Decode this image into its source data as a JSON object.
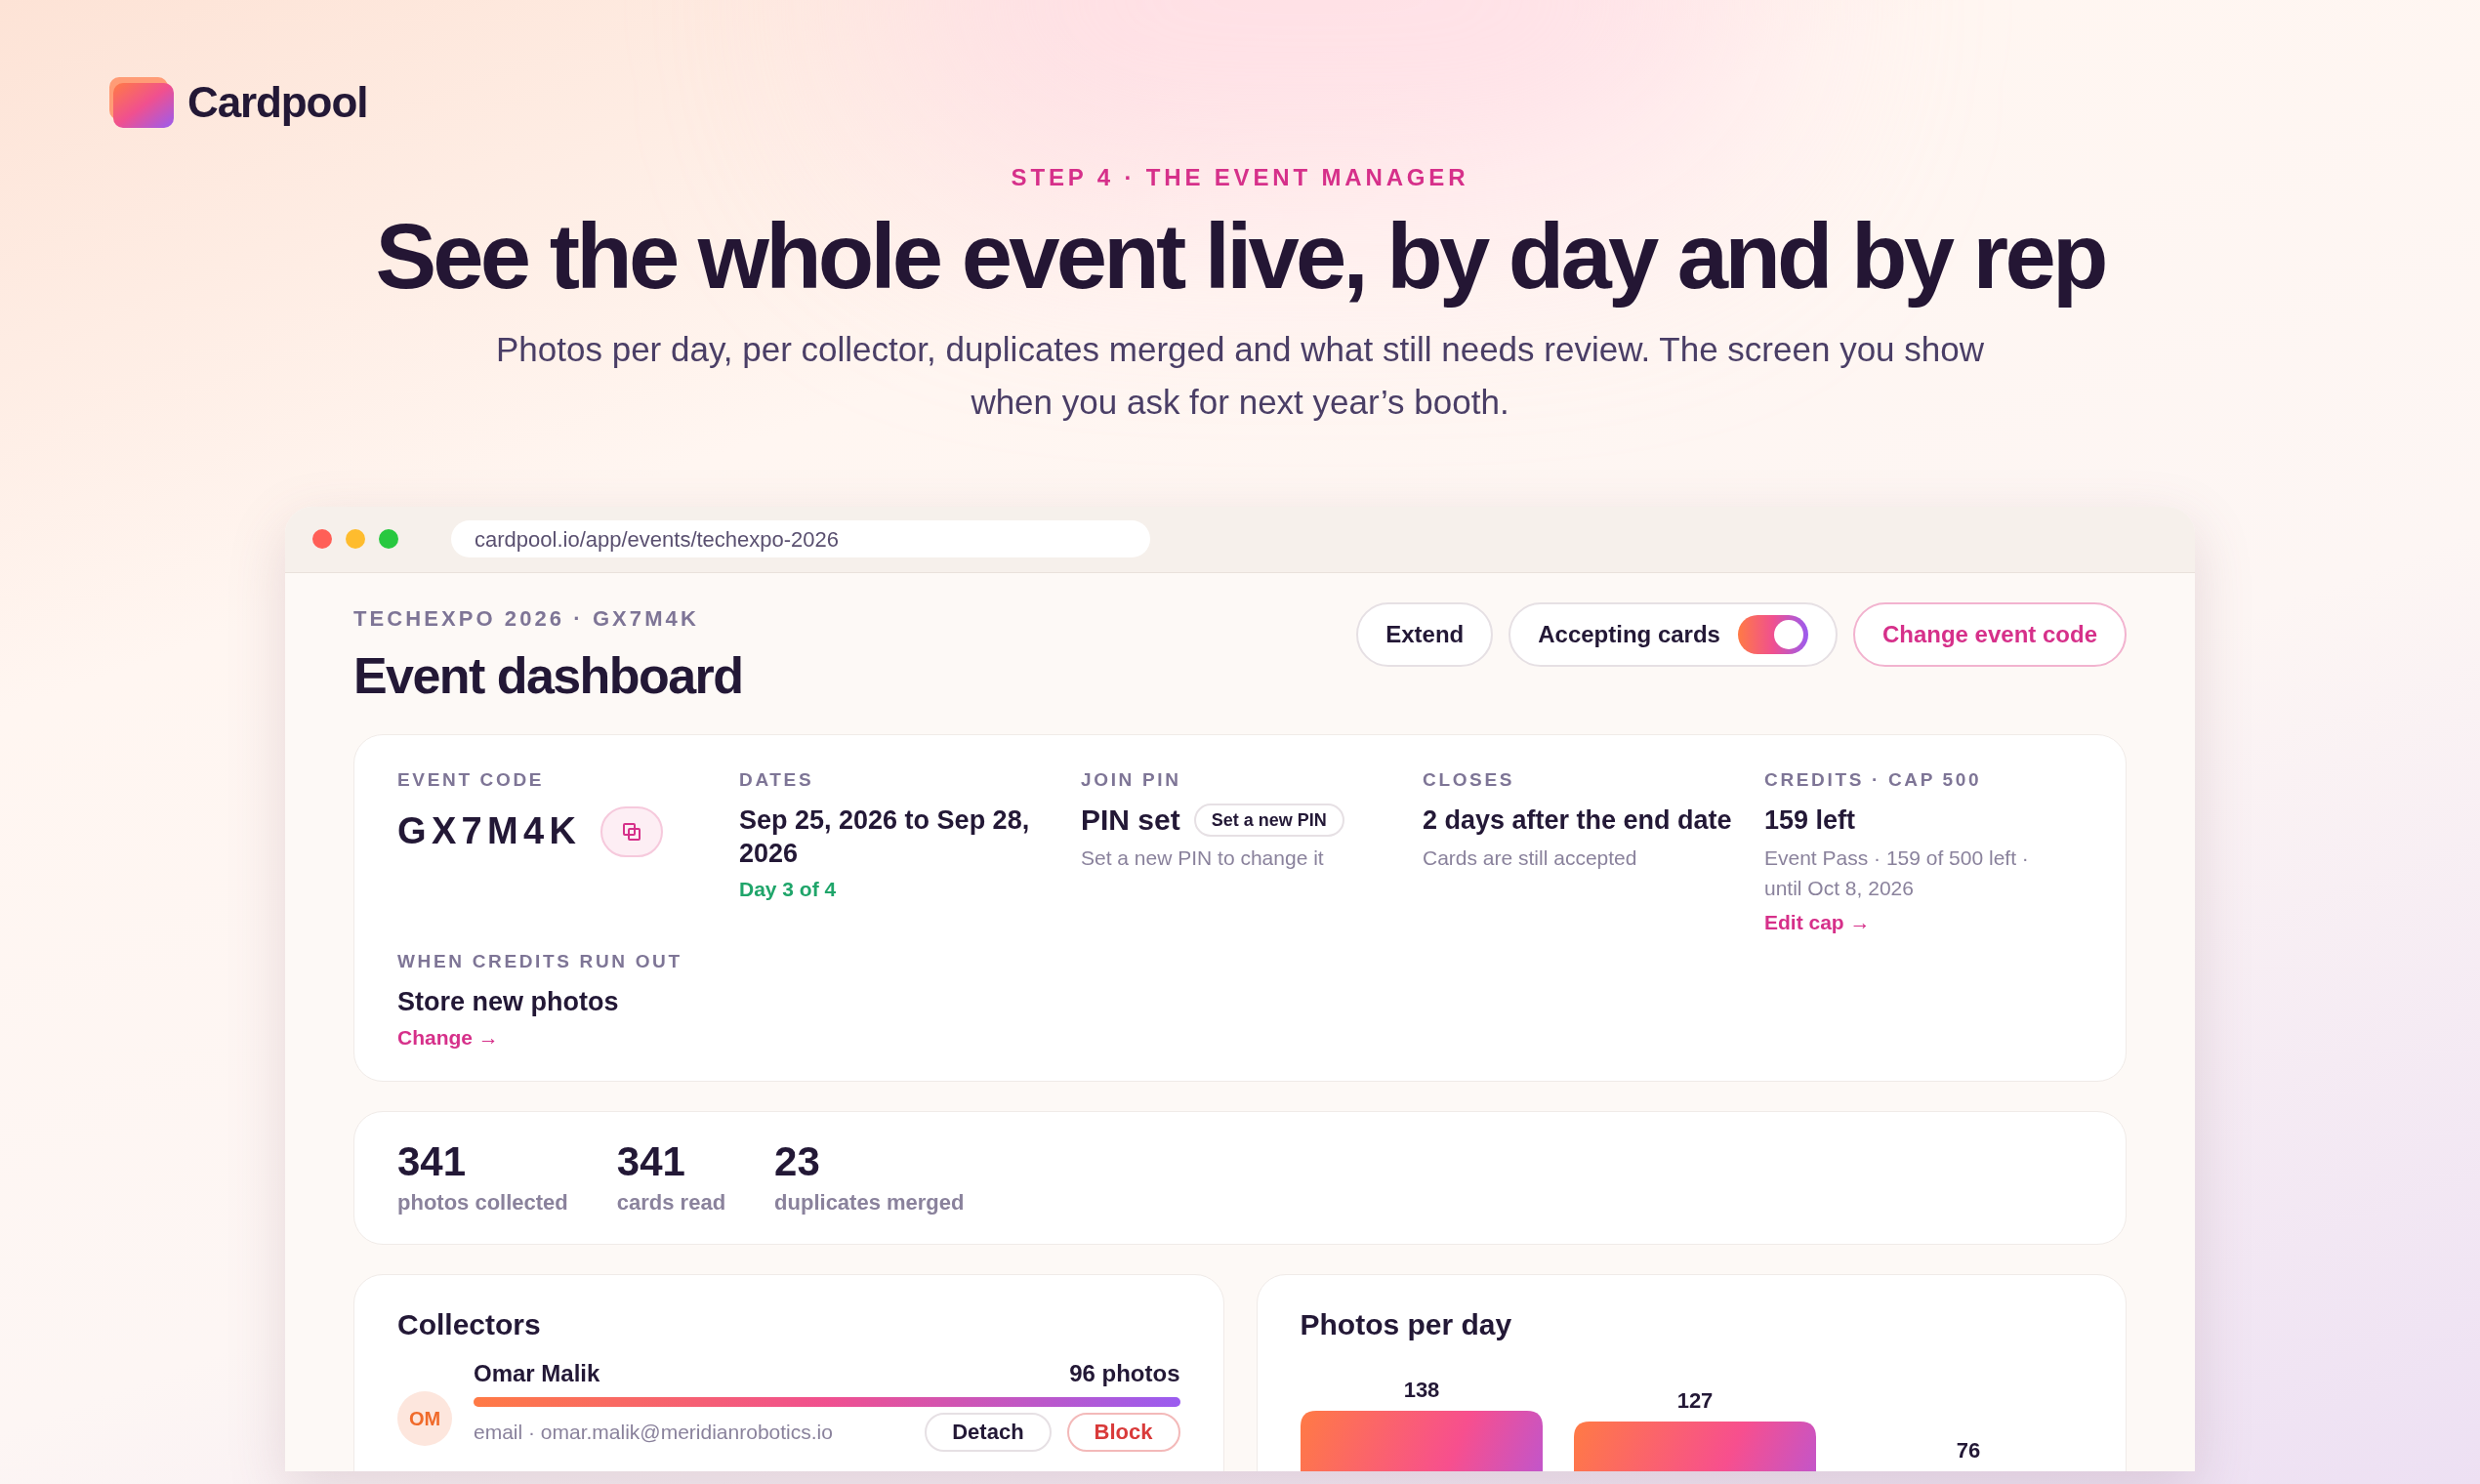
{
  "brand": {
    "name": "Cardpool"
  },
  "hero": {
    "eyebrow": "STEP 4 · THE EVENT MANAGER",
    "title": "See the whole event live, by day and by rep",
    "subtitle": "Photos per day, per collector, duplicates merged and what still needs review. The screen you show when you ask for next year’s booth."
  },
  "browser": {
    "url": "cardpool.io/app/events/techexpo-2026"
  },
  "dashboard": {
    "eyebrow": "TECHEXPO 2026 · GX7M4K",
    "title": "Event dashboard",
    "actions": [
      {
        "kind": "button",
        "label": "Extend"
      },
      {
        "kind": "toggle",
        "label": "Accepting cards",
        "on": true
      },
      {
        "kind": "accent",
        "label": "Change event code"
      }
    ]
  },
  "details": [
    {
      "kind": "code",
      "label": "EVENT CODE",
      "value": "GX7M4K"
    },
    {
      "kind": "plain",
      "label": "DATES",
      "value": "Sep 25, 2026 to Sep 28, 2026",
      "note": "Day 3 of 4",
      "live": true
    },
    {
      "kind": "plain",
      "label": "JOIN PIN",
      "value": "PIN set",
      "button": "Set a new PIN",
      "sub": "Set a new PIN to change it"
    },
    {
      "kind": "plain",
      "label": "CLOSES",
      "value": "2 days after the end date",
      "sub": "Cards are still accepted"
    },
    {
      "kind": "plain",
      "label": "CREDITS · CAP 500",
      "value": "159 left",
      "sub": "Event Pass · 159 of 500 left · until Oct 8, 2026",
      "link": "Edit cap →"
    },
    {
      "kind": "plain",
      "label": "WHEN CREDITS RUN OUT",
      "value": "Store new photos",
      "link": "Change →"
    }
  ],
  "stats": [
    {
      "value": "341",
      "label": "photos collected"
    },
    {
      "value": "341",
      "label": "cards read"
    },
    {
      "value": "23",
      "label": "duplicates merged"
    }
  ],
  "collectors": {
    "title": "Collectors",
    "rows": [
      {
        "initials": "OM",
        "name": "Omar Malik",
        "count": "96 photos",
        "level": 1,
        "email": "email · omar.malik@meridianrobotics.io",
        "actions": [
          {
            "kind": "neutral",
            "label": "Detach"
          },
          {
            "kind": "danger",
            "label": "Block"
          }
        ]
      }
    ]
  },
  "photos_per_day": {
    "title": "Photos per day",
    "bars": [
      {
        "value": "138"
      },
      {
        "value": "127"
      },
      {
        "value": "76"
      }
    ]
  }
}
